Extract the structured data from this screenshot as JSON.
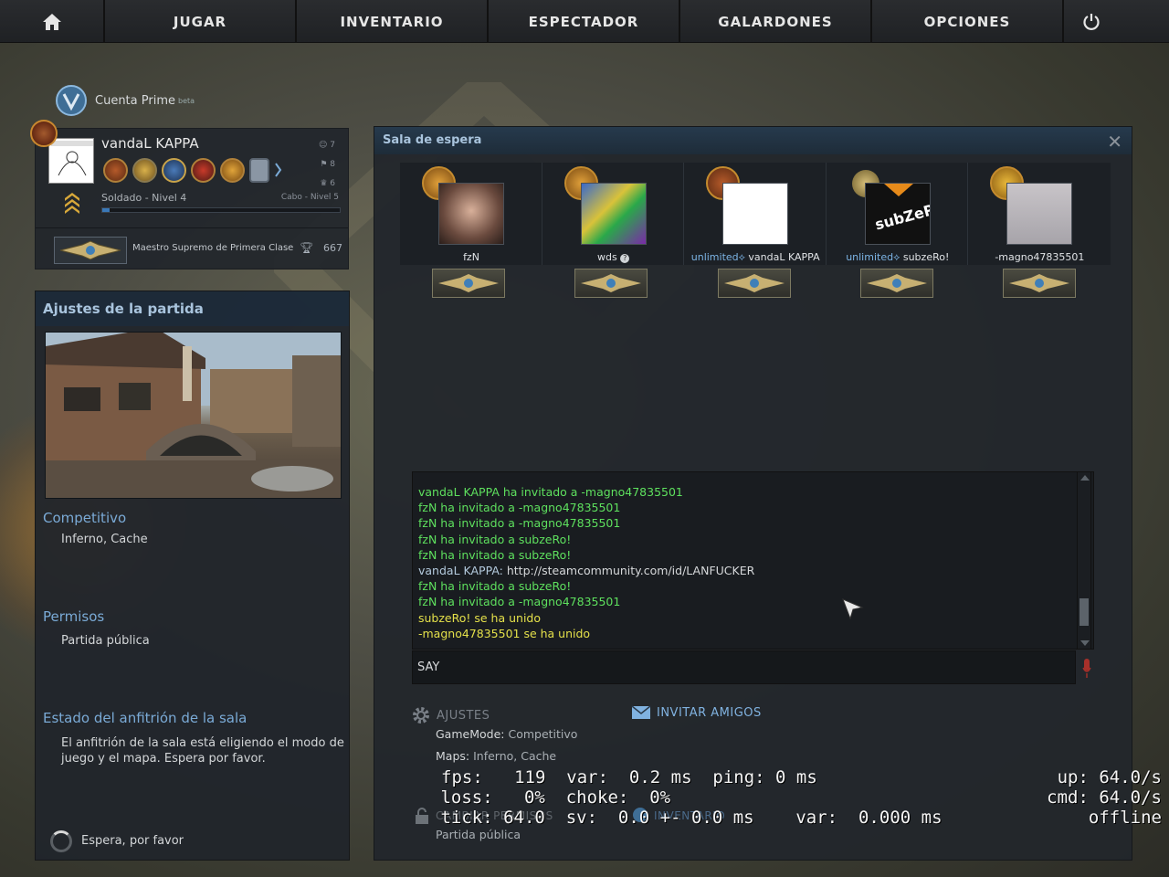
{
  "nav": {
    "home_icon": "home-icon",
    "items": [
      "JUGAR",
      "INVENTARIO",
      "ESPECTADOR",
      "GALARDONES",
      "OPCIONES"
    ],
    "power_icon": "power-icon"
  },
  "prime": {
    "label": "Cuenta Prime",
    "badge": "beta"
  },
  "profile": {
    "name": "vandaL KAPPA",
    "stats": {
      "friends": "7",
      "hat": "8",
      "crown": "6"
    },
    "rank_current": "Soldado - Nivel 4",
    "rank_next": "Cabo - Nivel 5",
    "xp_progress": 0.03,
    "skill_group": "Maestro Supremo de Primera Clase",
    "wins": "667"
  },
  "settings": {
    "title": "Ajustes de la partida",
    "mode_label": "Competitivo",
    "mode_value": "Inferno, Cache",
    "perm_label": "Permisos",
    "perm_value": "Partida pública",
    "host_label": "Estado del anfitrión de la sala",
    "host_value": "El anfitrión de la sala está eligiendo el modo de juego y el mapa. Espera por favor.",
    "wait": "Espera, por favor"
  },
  "lobby": {
    "title": "Sala de espera",
    "players": [
      {
        "group": "",
        "name": "fzN",
        "suffix": ""
      },
      {
        "group": "",
        "name": "wds",
        "suffix": "?"
      },
      {
        "group": "unlimited",
        "name": "vandaL KAPPA",
        "suffix": ""
      },
      {
        "group": "unlimited",
        "name": "subzeRo!",
        "suffix": ""
      },
      {
        "group": "",
        "name": "-magno47835501",
        "suffix": ""
      }
    ],
    "chat": [
      {
        "type": "invite",
        "text": "vandaL KAPPA ha invitado a -magno47835501"
      },
      {
        "type": "invite",
        "text": "fzN ha invitado a -magno47835501"
      },
      {
        "type": "invite",
        "text": "fzN ha invitado a -magno47835501"
      },
      {
        "type": "invite",
        "text": "fzN ha invitado a subzeRo!"
      },
      {
        "type": "invite",
        "text": "fzN ha invitado a subzeRo!"
      },
      {
        "type": "msg",
        "author": "vandaL KAPPA",
        "text": "http://steamcommunity.com/id/LANFUCKER"
      },
      {
        "type": "invite",
        "text": "fzN ha invitado a subzeRo!"
      },
      {
        "type": "invite",
        "text": "fzN ha invitado a -magno47835501"
      },
      {
        "type": "join",
        "text": "subzeRo! se ha unido"
      },
      {
        "type": "join",
        "text": "-magno47835501 se ha unido"
      }
    ],
    "say_label": "SAY",
    "settings_link": "AJUSTES",
    "invite_link": "INVITAR AMIGOS",
    "gamemode_label": "GameMode:",
    "gamemode_value": "Competitivo",
    "maps_label": "Maps:",
    "maps_value": "Inferno, Cache",
    "perm_link": "CAMBIAR PERMISOS",
    "inv_link": "INVENTARIO",
    "perm_value": "Partida pública"
  },
  "netgraph": {
    "line1": "fps:   119  var:  0.2 ms  ping: 0 ms",
    "line2": " loss:   0%  choke:  0%",
    "line3": " tick: 64.0  sv:  0.0 +- 0.0 ms    var:  0.000 ms",
    "right1": "up: 64.0/s",
    "right2": "cmd: 64.0/s",
    "right3": "offline"
  },
  "colors": {
    "invite": "#5ee05e",
    "join": "#e4e04a",
    "author": "#b4cadd",
    "accent": "#7aaad6"
  }
}
